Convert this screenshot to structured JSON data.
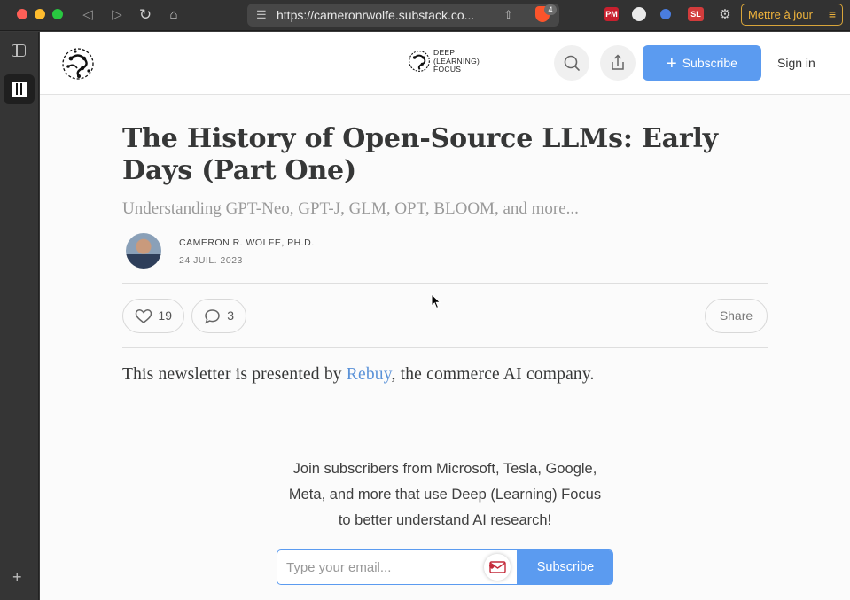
{
  "browser": {
    "url": "https://cameronrwolfe.substack.co...",
    "brave_badge": "4",
    "update_label": "Mettre à jour",
    "extensions": [
      {
        "name": "pm-ext",
        "label": "PM",
        "color": "#c8202e"
      },
      {
        "name": "ghostery-ext",
        "label": "",
        "color": "#eaeaea"
      },
      {
        "name": "blue-ext",
        "label": "",
        "color": "#4a7de0"
      },
      {
        "name": "sl-ext",
        "label": "SL",
        "color": "#d23c3c"
      }
    ]
  },
  "header": {
    "logo_text": [
      "DEEP",
      "(LEARNING)",
      "FOCUS"
    ],
    "subscribe_label": "Subscribe",
    "signin_label": "Sign in"
  },
  "post": {
    "title": "The History of Open-Source LLMs: Early Days (Part One)",
    "subtitle": "Understanding GPT-Neo, GPT-J, GLM, OPT, BLOOM, and more...",
    "author": "CAMERON R. WOLFE, PH.D.",
    "date": "24 JUIL. 2023",
    "likes": "19",
    "comments": "3",
    "share_label": "Share",
    "presented_prefix": "This newsletter is presented by ",
    "presented_link": "Rebuy",
    "presented_suffix": ", the commerce AI company."
  },
  "signup": {
    "line1": "Join subscribers from Microsoft, Tesla, Google,",
    "line2": "Meta, and more that use Deep (Learning) Focus",
    "line3": "to better understand AI research!",
    "placeholder": "Type your email...",
    "submit_label": "Subscribe"
  }
}
